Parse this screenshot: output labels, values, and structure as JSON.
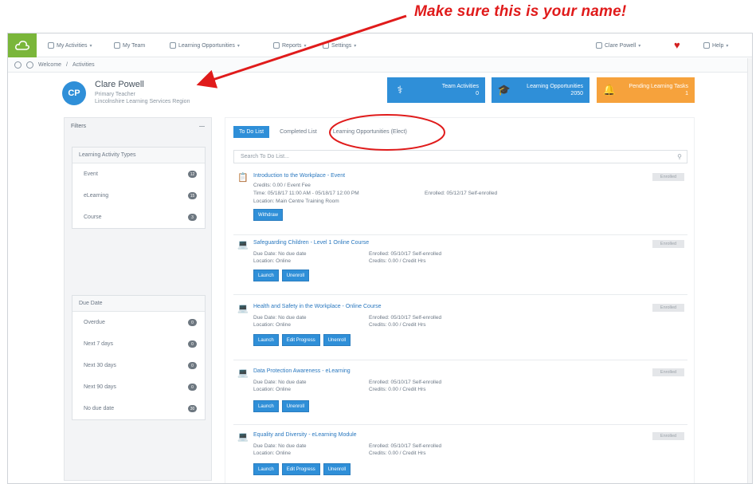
{
  "annotation": {
    "text": "Make sure this is your name!",
    "color": "#e01b1b"
  },
  "nav": {
    "items": [
      {
        "label": "My Activities",
        "icon": "grid-icon"
      },
      {
        "label": "My Team",
        "icon": "team-icon"
      },
      {
        "label": "Learning Opportunities",
        "icon": "phone-icon"
      },
      {
        "label": "Reports",
        "icon": "chart-icon"
      },
      {
        "label": "Settings",
        "icon": "gear-icon"
      }
    ],
    "user_label": "Clare Powell",
    "help_label": "Help"
  },
  "breadcrumb": {
    "items": [
      "Welcome",
      "Activities"
    ]
  },
  "profile": {
    "initials": "CP",
    "name": "Clare Powell",
    "role": "Primary Teacher",
    "org": "Lincolnshire Learning Services Region"
  },
  "tiles": [
    {
      "label": "Team Activities",
      "count": "0",
      "color": "#2f8fd8",
      "icon": "stethoscope-icon"
    },
    {
      "label": "Learning Opportunities",
      "count": "2050",
      "color": "#2f8fd8",
      "icon": "mortarboard-icon"
    },
    {
      "label": "Pending Learning Tasks",
      "count": "1",
      "color": "#f6a23c",
      "icon": "bell-icon"
    }
  ],
  "filters": {
    "header": "Filters",
    "types_title": "Learning Activity Types",
    "types": [
      {
        "label": "Event",
        "count": "12"
      },
      {
        "label": "eLearning",
        "count": "15"
      },
      {
        "label": "Course",
        "count": "3"
      }
    ],
    "due_title": "Due Date",
    "due": [
      {
        "label": "Overdue",
        "count": "0"
      },
      {
        "label": "Next 7 days",
        "count": "0"
      },
      {
        "label": "Next 30 days",
        "count": "0"
      },
      {
        "label": "Next 90 days",
        "count": "0"
      },
      {
        "label": "No due date",
        "count": "30"
      }
    ]
  },
  "main": {
    "tabs": [
      "To Do List",
      "Completed List",
      "Learning Opportunities (Elect)"
    ],
    "search_placeholder": "Search To Do List...",
    "items": [
      {
        "icon": "clipboard-icon",
        "title": "Introduction to the Workplace - Event",
        "l1": "Credits: 0.00 / Event Fee",
        "l2": "Time: 05/18/17 11:00 AM - 05/18/17 12:00 PM",
        "l2b": "Enrolled: 05/12/17 Self-enrolled",
        "l3": "Location: Main Centre Training Room",
        "badge": "Enrolled",
        "buttons": [
          "Withdraw"
        ]
      },
      {
        "icon": "laptop-icon",
        "title": "Safeguarding Children - Level 1 Online Course",
        "l1": "Due Date: No due date",
        "l1b": "Enrolled: 05/10/17 Self-enrolled",
        "l2": "Location: Online",
        "l2b": "Credits: 0.00 / Credit Hrs",
        "badge": "Enrolled",
        "buttons": [
          "Launch",
          "Unenroll"
        ]
      },
      {
        "icon": "laptop-icon",
        "title": "Health and Safety in the Workplace - Online Course",
        "l1": "Due Date: No due date",
        "l1b": "Enrolled: 05/10/17 Self-enrolled",
        "l2": "Location: Online",
        "l2b": "Credits: 0.00 / Credit Hrs",
        "badge": "Enrolled",
        "buttons": [
          "Launch",
          "Edit Progress",
          "Unenroll"
        ]
      },
      {
        "icon": "laptop-icon",
        "title": "Data Protection Awareness - eLearning",
        "l1": "Due Date: No due date",
        "l1b": "Enrolled: 05/10/17 Self-enrolled",
        "l2": "Location: Online",
        "l2b": "Credits: 0.00 / Credit Hrs",
        "badge": "Enrolled",
        "buttons": [
          "Launch",
          "Unenroll"
        ]
      },
      {
        "icon": "laptop-icon",
        "title": "Equality and Diversity - eLearning Module",
        "l1": "Due Date: No due date",
        "l1b": "Enrolled: 05/10/17 Self-enrolled",
        "l2": "Location: Online",
        "l2b": "Credits: 0.00 / Credit Hrs",
        "badge": "Enrolled",
        "buttons": [
          "Launch",
          "Edit Progress",
          "Unenroll"
        ]
      }
    ]
  }
}
